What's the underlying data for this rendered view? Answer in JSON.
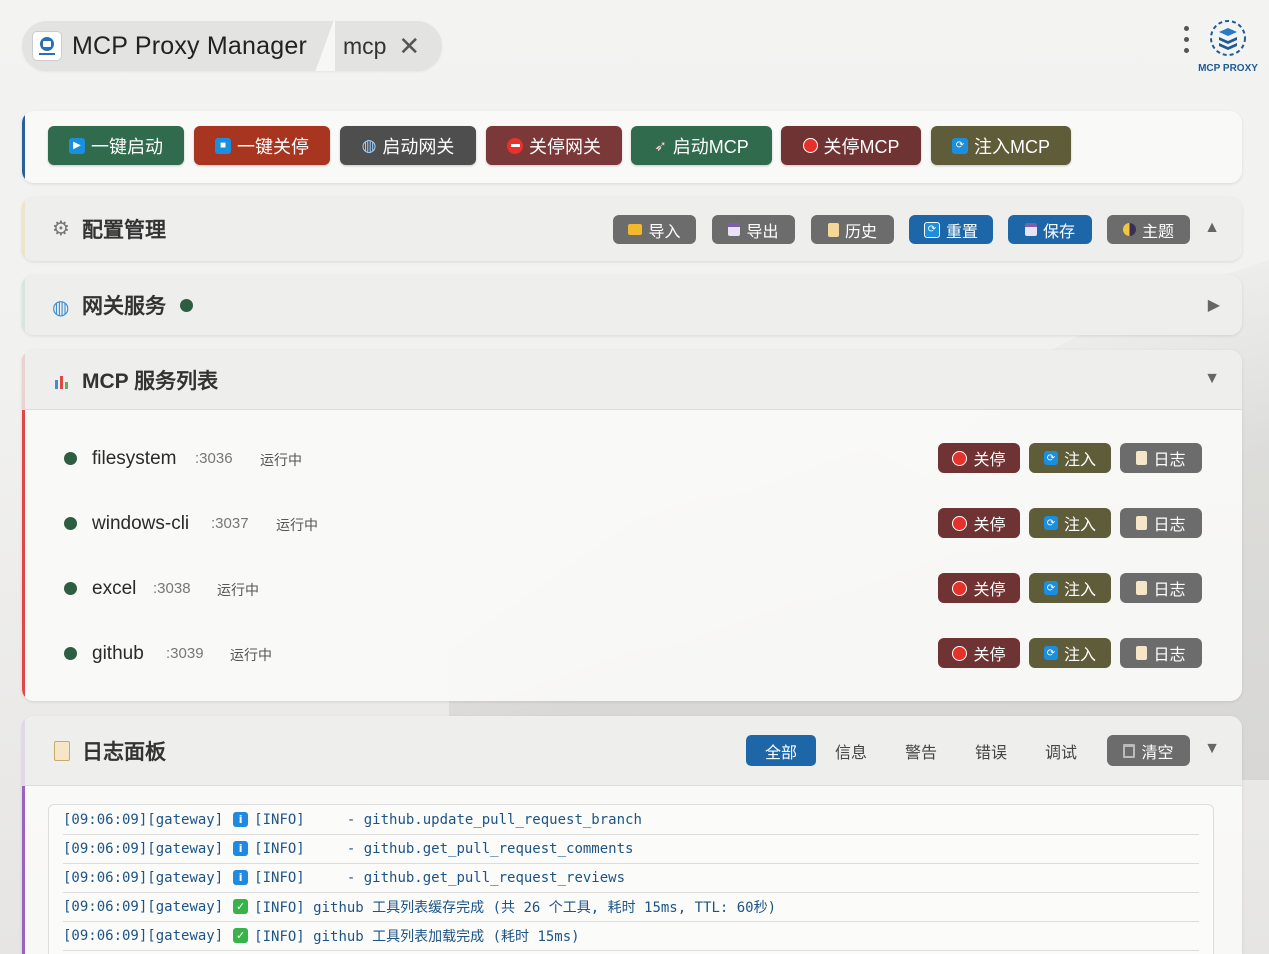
{
  "app": {
    "title": "MCP Proxy Manager",
    "tab": "mcp",
    "brand": "MCP PROXY",
    "logo_caption": "MCP PROXY"
  },
  "toolbar": [
    {
      "label": "一键启动",
      "icon": "play-icon",
      "color": "#2f6b4c"
    },
    {
      "label": "一键关停",
      "icon": "stop-icon",
      "color": "#a83520"
    },
    {
      "label": "启动网关",
      "icon": "globe-icon",
      "color": "#4e4e4e"
    },
    {
      "label": "关停网关",
      "icon": "no-entry-icon",
      "color": "#7a3838"
    },
    {
      "label": "启动MCP",
      "icon": "rocket-icon",
      "color": "#2f6b4c"
    },
    {
      "label": "关停MCP",
      "icon": "red-circle-icon",
      "color": "#6e3332"
    },
    {
      "label": "注入MCP",
      "icon": "refresh-icon",
      "color": "#5f5c3a"
    }
  ],
  "config": {
    "title": "配置管理",
    "actions": [
      {
        "label": "导入",
        "icon": "folder-icon",
        "color": "#6c6c6c"
      },
      {
        "label": "导出",
        "icon": "floppy-icon",
        "color": "#6c6c6c"
      },
      {
        "label": "历史",
        "icon": "scroll-icon",
        "color": "#6c6c6c"
      },
      {
        "label": "重置",
        "icon": "refresh-icon",
        "color": "#1d67a8"
      },
      {
        "label": "保存",
        "icon": "floppy-icon",
        "color": "#1d67a8"
      },
      {
        "label": "主题",
        "icon": "moon-icon",
        "color": "#6c6c6c"
      }
    ]
  },
  "gateway": {
    "title": "网关服务"
  },
  "services": {
    "title": "MCP 服务列表",
    "items": [
      {
        "name": "filesystem",
        "port": ":3036",
        "status": "运行中"
      },
      {
        "name": "windows-cli",
        "port": ":3037",
        "status": "运行中"
      },
      {
        "name": "excel",
        "port": ":3038",
        "status": "运行中"
      },
      {
        "name": "github",
        "port": ":3039",
        "status": "运行中"
      }
    ],
    "actions": {
      "stop": "关停",
      "inject": "注入",
      "log": "日志"
    }
  },
  "logs": {
    "title": "日志面板",
    "filters": [
      "全部",
      "信息",
      "警告",
      "错误",
      "调试"
    ],
    "active_filter": "全部",
    "clear": "清空",
    "lines": [
      {
        "time": "[09:06:09]",
        "source": "[gateway]",
        "level_icon": "info-icon",
        "text": "[INFO]     - github.update_pull_request_branch"
      },
      {
        "time": "[09:06:09]",
        "source": "[gateway]",
        "level_icon": "info-icon",
        "text": "[INFO]     - github.get_pull_request_comments"
      },
      {
        "time": "[09:06:09]",
        "source": "[gateway]",
        "level_icon": "info-icon",
        "text": "[INFO]     - github.get_pull_request_reviews"
      },
      {
        "time": "[09:06:09]",
        "source": "[gateway]",
        "level_icon": "check-icon",
        "text": "[INFO] github 工具列表缓存完成 (共 26 个工具, 耗时 15ms, TTL: 60秒)"
      },
      {
        "time": "[09:06:09]",
        "source": "[gateway]",
        "level_icon": "check-icon",
        "text": "[INFO] github 工具列表加载完成 (耗时 15ms)"
      }
    ]
  }
}
